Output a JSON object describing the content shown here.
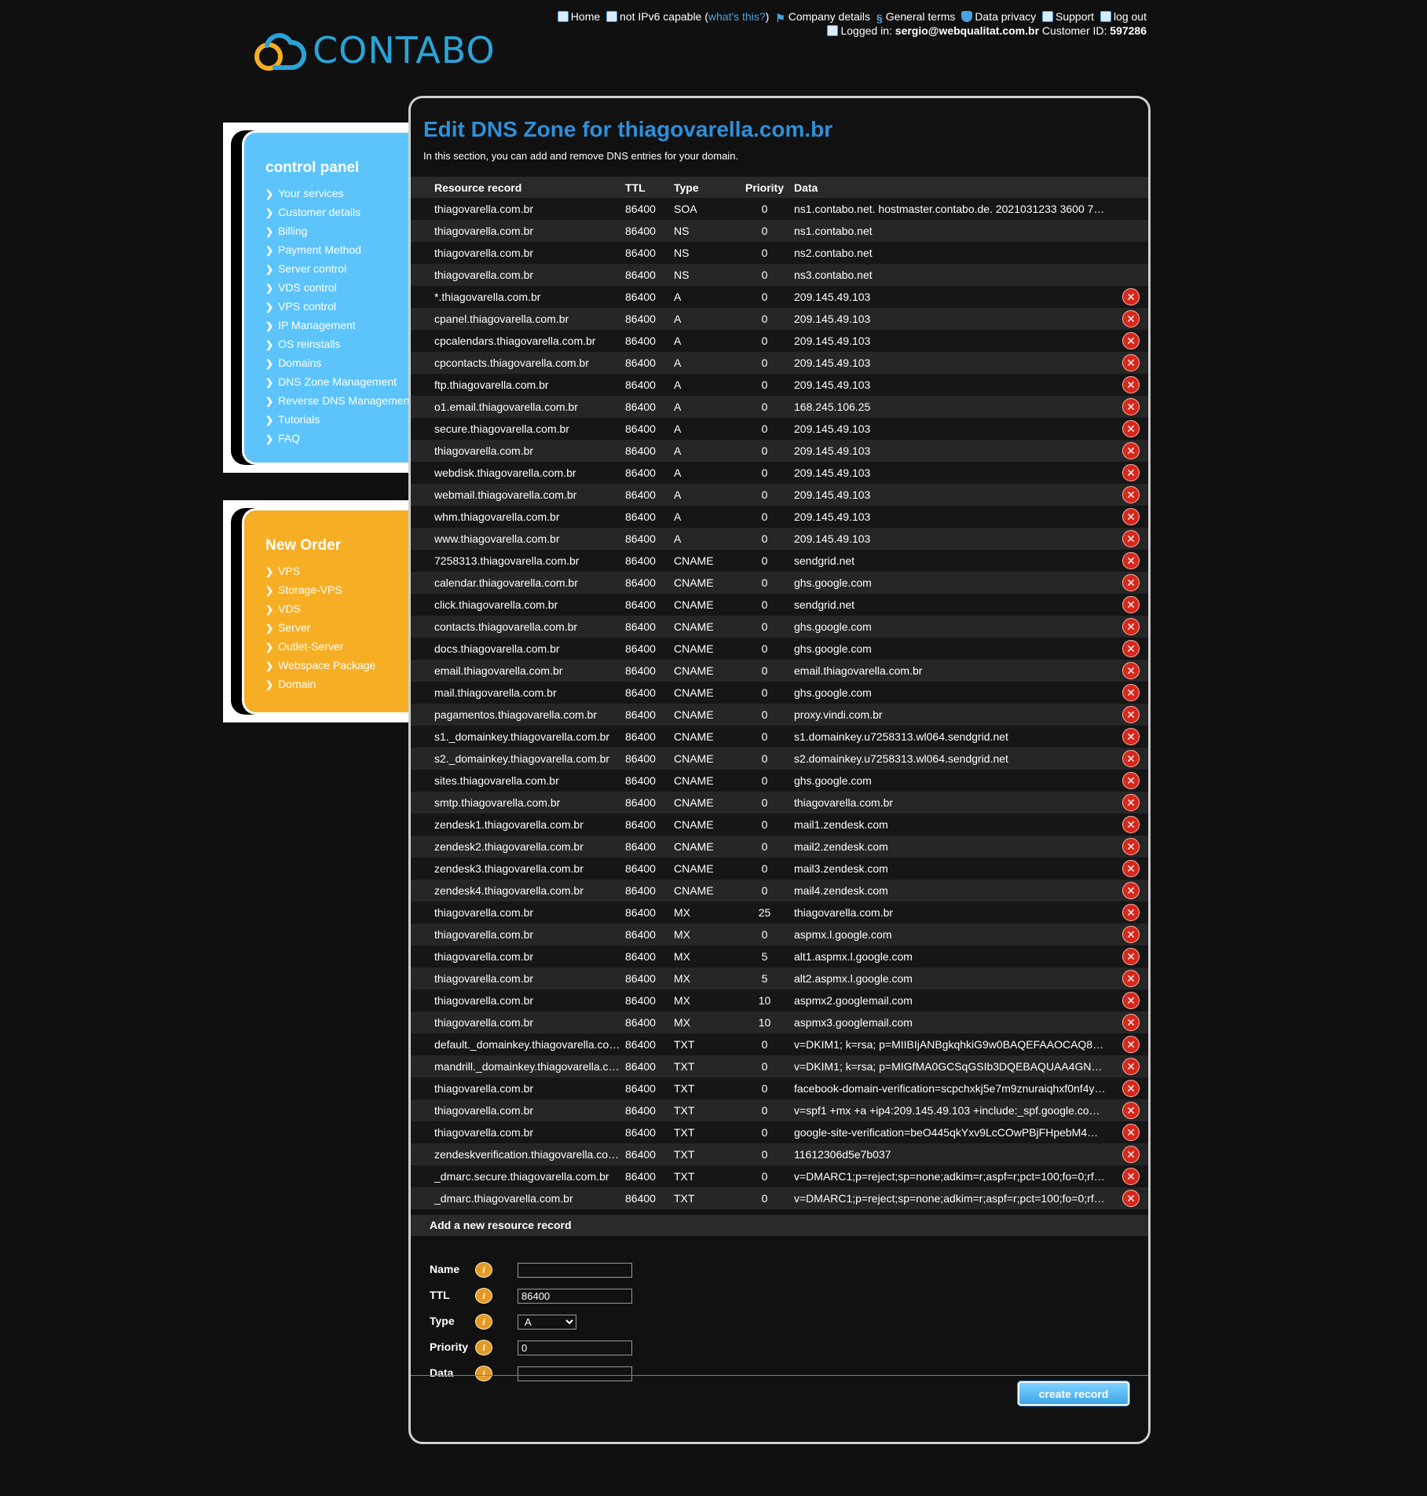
{
  "topnav": {
    "home": "Home",
    "ipv6": "not IPv6 capable",
    "whats_this": "what's this?",
    "company_details": "Company details",
    "general_terms": "General terms",
    "data_privacy": "Data privacy",
    "support": "Support",
    "logout": "log out",
    "logged_in_label": "Logged in:",
    "email": "sergio@webqualitat.com.br",
    "customer_id_label": "Customer ID:",
    "customer_id": "597286"
  },
  "logo": {
    "text": "CONTABO"
  },
  "control_panel": {
    "title": "control panel",
    "items": [
      "Your services",
      "Customer details",
      "Billing",
      "Payment Method",
      "Server control",
      "VDS control",
      "VPS control",
      "IP Management",
      "OS reinstalls",
      "Domains",
      "DNS Zone Management",
      "Reverse DNS Management",
      "Tutorials",
      "FAQ"
    ]
  },
  "new_order": {
    "title": "New Order",
    "items": [
      "VPS",
      "Storage-VPS",
      "VDS",
      "Server",
      "Outlet-Server",
      "Webspace Package",
      "Domain"
    ]
  },
  "main": {
    "title": "Edit DNS Zone for thiagovarella.com.br",
    "intro": "In this section, you can add and remove DNS entries for your domain."
  },
  "table": {
    "headers": [
      "Resource record",
      "TTL",
      "Type",
      "Priority",
      "Data"
    ],
    "rows": [
      [
        "thiagovarella.com.br",
        "86400",
        "SOA",
        "0",
        "ns1.contabo.net. hostmaster.contabo.de. 2021031233 3600 7…",
        false
      ],
      [
        "thiagovarella.com.br",
        "86400",
        "NS",
        "0",
        "ns1.contabo.net",
        false
      ],
      [
        "thiagovarella.com.br",
        "86400",
        "NS",
        "0",
        "ns2.contabo.net",
        false
      ],
      [
        "thiagovarella.com.br",
        "86400",
        "NS",
        "0",
        "ns3.contabo.net",
        false
      ],
      [
        "*.thiagovarella.com.br",
        "86400",
        "A",
        "0",
        "209.145.49.103",
        true
      ],
      [
        "cpanel.thiagovarella.com.br",
        "86400",
        "A",
        "0",
        "209.145.49.103",
        true
      ],
      [
        "cpcalendars.thiagovarella.com.br",
        "86400",
        "A",
        "0",
        "209.145.49.103",
        true
      ],
      [
        "cpcontacts.thiagovarella.com.br",
        "86400",
        "A",
        "0",
        "209.145.49.103",
        true
      ],
      [
        "ftp.thiagovarella.com.br",
        "86400",
        "A",
        "0",
        "209.145.49.103",
        true
      ],
      [
        "o1.email.thiagovarella.com.br",
        "86400",
        "A",
        "0",
        "168.245.106.25",
        true
      ],
      [
        "secure.thiagovarella.com.br",
        "86400",
        "A",
        "0",
        "209.145.49.103",
        true
      ],
      [
        "thiagovarella.com.br",
        "86400",
        "A",
        "0",
        "209.145.49.103",
        true
      ],
      [
        "webdisk.thiagovarella.com.br",
        "86400",
        "A",
        "0",
        "209.145.49.103",
        true
      ],
      [
        "webmail.thiagovarella.com.br",
        "86400",
        "A",
        "0",
        "209.145.49.103",
        true
      ],
      [
        "whm.thiagovarella.com.br",
        "86400",
        "A",
        "0",
        "209.145.49.103",
        true
      ],
      [
        "www.thiagovarella.com.br",
        "86400",
        "A",
        "0",
        "209.145.49.103",
        true
      ],
      [
        "7258313.thiagovarella.com.br",
        "86400",
        "CNAME",
        "0",
        "sendgrid.net",
        true
      ],
      [
        "calendar.thiagovarella.com.br",
        "86400",
        "CNAME",
        "0",
        "ghs.google.com",
        true
      ],
      [
        "click.thiagovarella.com.br",
        "86400",
        "CNAME",
        "0",
        "sendgrid.net",
        true
      ],
      [
        "contacts.thiagovarella.com.br",
        "86400",
        "CNAME",
        "0",
        "ghs.google.com",
        true
      ],
      [
        "docs.thiagovarella.com.br",
        "86400",
        "CNAME",
        "0",
        "ghs.google.com",
        true
      ],
      [
        "email.thiagovarella.com.br",
        "86400",
        "CNAME",
        "0",
        "email.thiagovarella.com.br",
        true
      ],
      [
        "mail.thiagovarella.com.br",
        "86400",
        "CNAME",
        "0",
        "ghs.google.com",
        true
      ],
      [
        "pagamentos.thiagovarella.com.br",
        "86400",
        "CNAME",
        "0",
        "proxy.vindi.com.br",
        true
      ],
      [
        "s1._domainkey.thiagovarella.com.br",
        "86400",
        "CNAME",
        "0",
        "s1.domainkey.u7258313.wl064.sendgrid.net",
        true
      ],
      [
        "s2._domainkey.thiagovarella.com.br",
        "86400",
        "CNAME",
        "0",
        "s2.domainkey.u7258313.wl064.sendgrid.net",
        true
      ],
      [
        "sites.thiagovarella.com.br",
        "86400",
        "CNAME",
        "0",
        "ghs.google.com",
        true
      ],
      [
        "smtp.thiagovarella.com.br",
        "86400",
        "CNAME",
        "0",
        "thiagovarella.com.br",
        true
      ],
      [
        "zendesk1.thiagovarella.com.br",
        "86400",
        "CNAME",
        "0",
        "mail1.zendesk.com",
        true
      ],
      [
        "zendesk2.thiagovarella.com.br",
        "86400",
        "CNAME",
        "0",
        "mail2.zendesk.com",
        true
      ],
      [
        "zendesk3.thiagovarella.com.br",
        "86400",
        "CNAME",
        "0",
        "mail3.zendesk.com",
        true
      ],
      [
        "zendesk4.thiagovarella.com.br",
        "86400",
        "CNAME",
        "0",
        "mail4.zendesk.com",
        true
      ],
      [
        "thiagovarella.com.br",
        "86400",
        "MX",
        "25",
        "thiagovarella.com.br",
        true
      ],
      [
        "thiagovarella.com.br",
        "86400",
        "MX",
        "0",
        "aspmx.l.google.com",
        true
      ],
      [
        "thiagovarella.com.br",
        "86400",
        "MX",
        "5",
        "alt1.aspmx.l.google.com",
        true
      ],
      [
        "thiagovarella.com.br",
        "86400",
        "MX",
        "5",
        "alt2.aspmx.l.google.com",
        true
      ],
      [
        "thiagovarella.com.br",
        "86400",
        "MX",
        "10",
        "aspmx2.googlemail.com",
        true
      ],
      [
        "thiagovarella.com.br",
        "86400",
        "MX",
        "10",
        "aspmx3.googlemail.com",
        true
      ],
      [
        "default._domainkey.thiagovarella.com.br",
        "86400",
        "TXT",
        "0",
        "v=DKIM1; k=rsa; p=MIIBIjANBgkqhkiG9w0BAQEFAAOCAQ8…",
        true
      ],
      [
        "mandrill._domainkey.thiagovarella.com.br",
        "86400",
        "TXT",
        "0",
        "v=DKIM1; k=rsa; p=MIGfMA0GCSqGSIb3DQEBAQUAA4GN…",
        true
      ],
      [
        "thiagovarella.com.br",
        "86400",
        "TXT",
        "0",
        "facebook-domain-verification=scpchxkj5e7m9znuraiqhxf0nf4y…",
        true
      ],
      [
        "thiagovarella.com.br",
        "86400",
        "TXT",
        "0",
        "v=spf1 +mx +a +ip4:209.145.49.103 +include:_spf.google.co…",
        true
      ],
      [
        "thiagovarella.com.br",
        "86400",
        "TXT",
        "0",
        "google-site-verification=beO445qkYxv9LcCOwPBjFHpebM4…",
        true
      ],
      [
        "zendeskverification.thiagovarella.com.br",
        "86400",
        "TXT",
        "0",
        "11612306d5e7b037",
        true
      ],
      [
        "_dmarc.secure.thiagovarella.com.br",
        "86400",
        "TXT",
        "0",
        "v=DMARC1;p=reject;sp=none;adkim=r;aspf=r;pct=100;fo=0;rf…",
        true
      ],
      [
        "_dmarc.thiagovarella.com.br",
        "86400",
        "TXT",
        "0",
        "v=DMARC1;p=reject;sp=none;adkim=r;aspf=r;pct=100;fo=0;rf…",
        true
      ]
    ]
  },
  "add_form": {
    "header": "Add a new resource record",
    "name_label": "Name",
    "name_value": "",
    "ttl_label": "TTL",
    "ttl_value": "86400",
    "type_label": "Type",
    "type_value": "A",
    "priority_label": "Priority",
    "priority_value": "0",
    "data_label": "Data",
    "data_value": "",
    "submit_label": "create record"
  },
  "colors": {
    "accent_blue": "#2f8fd8",
    "panel_blue": "#5cc4fb",
    "panel_orange": "#f6ae25",
    "delete_red": "#d7271d"
  }
}
